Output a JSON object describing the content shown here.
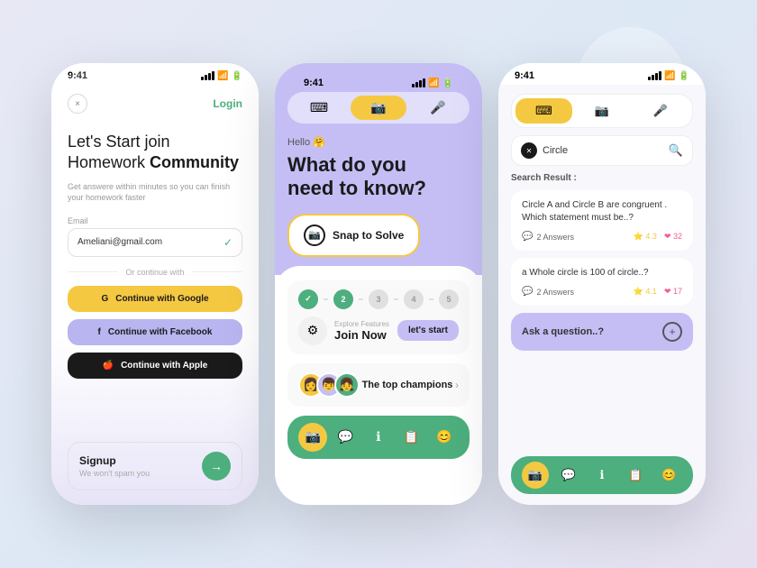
{
  "background": "#e4e0f0",
  "phone1": {
    "time": "9:41",
    "close_label": "×",
    "login_label": "Login",
    "headline_part1": "Let's Start join\nHomework ",
    "headline_bold": "Community",
    "sub_text": "Get answere within minutes so you can finish your homework faster",
    "email_label": "Email",
    "email_value": "Ameliani@gmail.com",
    "divider_text": "Or continue with",
    "google_btn": "Continue with Google",
    "facebook_btn": "Continue with Facebook",
    "apple_btn": "Continue with Apple",
    "signup_title": "Signup",
    "signup_sub": "We won't spam you"
  },
  "phone2": {
    "time": "9:41",
    "hello_text": "Hello 🤗",
    "main_heading": "What do you\nneed to know?",
    "snap_btn": "Snap to Solve",
    "steps": [
      "✓",
      "2",
      "3",
      "4",
      "5"
    ],
    "explore_label": "Explore Features",
    "join_now": "Join Now",
    "start_btn": "let's start",
    "champions_text": "The top champions",
    "nav_icons": [
      "📷",
      "💬",
      "ℹ",
      "📋",
      "😊"
    ]
  },
  "phone3": {
    "time": "9:41",
    "search_value": "Circle",
    "result_label": "Search Result :",
    "results": [
      {
        "question": "Circle A and Circle B are congruent . Which statement must be..?",
        "answers": "2 Answers",
        "rating": "4.3",
        "hearts": "32"
      },
      {
        "question": "a Whole circle is 100 of circle..?",
        "answers": "2 Answers",
        "rating": "4.1",
        "hearts": "17"
      }
    ],
    "ask_label": "Ask a question..?",
    "nav_icons": [
      "📷",
      "💬",
      "ℹ",
      "📋",
      "😊"
    ]
  }
}
